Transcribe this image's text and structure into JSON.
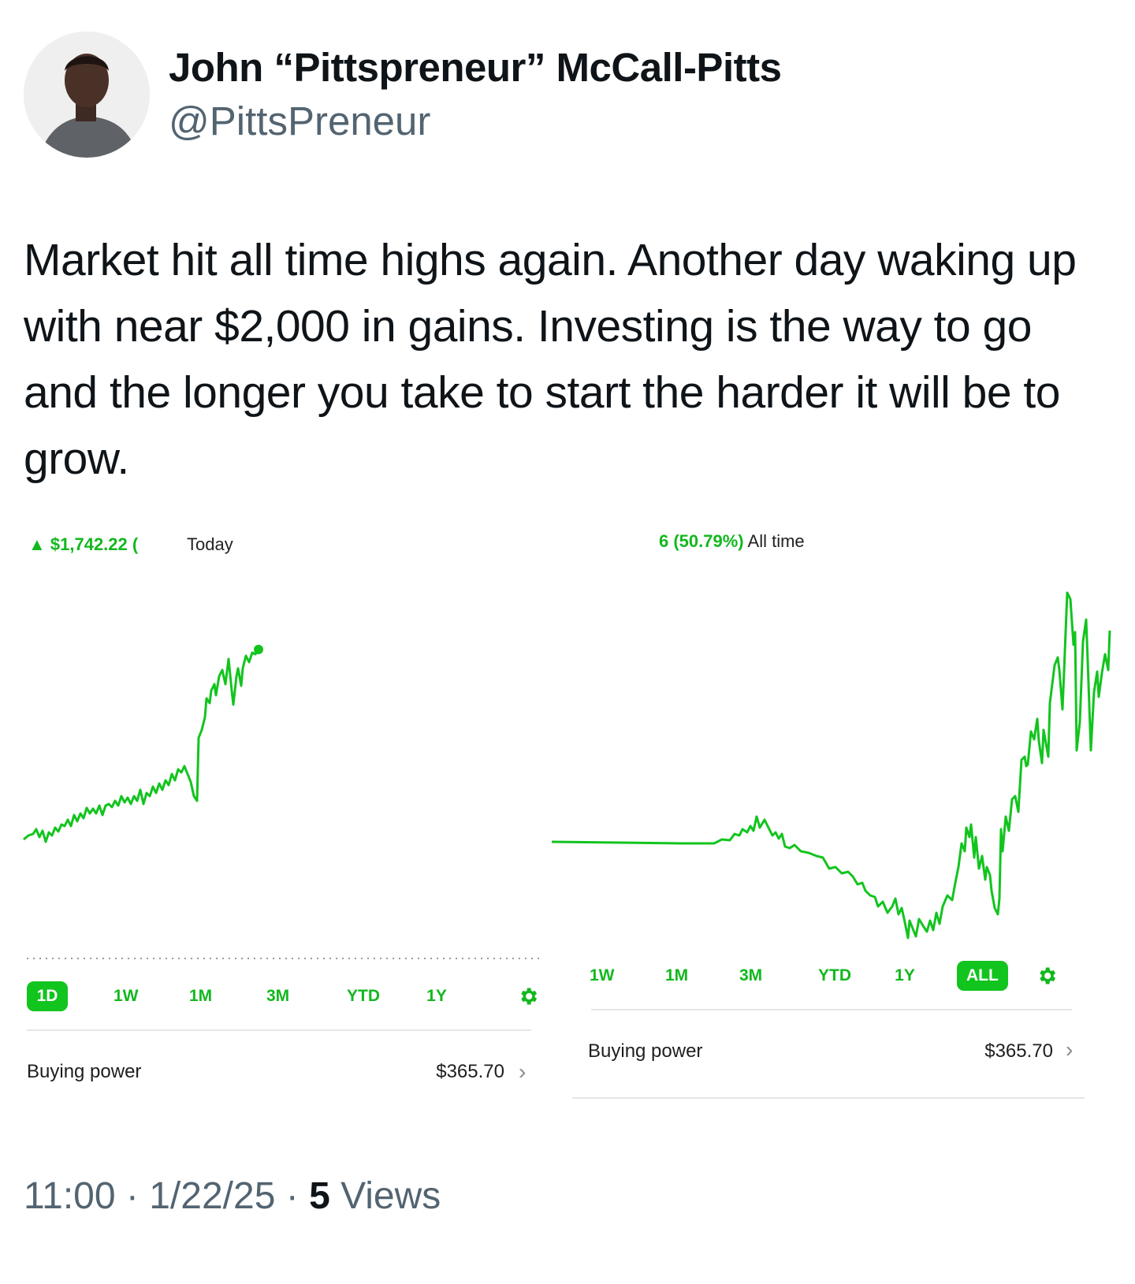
{
  "author": {
    "name": "John “Pittspreneur” McCall-Pitts",
    "handle": "@PittsPreneur"
  },
  "tweet": {
    "text": "Market hit all time highs again. Another day waking up with near $2,000 in gains. Investing is the way to go and the longer you take to start the harder it will be to grow."
  },
  "screenshot_left": {
    "gain_text": "▲ $1,742.22 (",
    "period": "Today",
    "ranges": [
      "1D",
      "1W",
      "1M",
      "3M",
      "YTD",
      "1Y"
    ],
    "active_range": "1D",
    "buying_power_label": "Buying power",
    "buying_power_value": "$365.70"
  },
  "screenshot_right": {
    "gain_text": "6 (50.79%)",
    "period": "All time",
    "ranges": [
      "1W",
      "1M",
      "3M",
      "YTD",
      "1Y",
      "ALL"
    ],
    "active_range": "ALL",
    "buying_power_label": "Buying power",
    "buying_power_value": "$365.70"
  },
  "footer": {
    "time": "11:00",
    "date": "1/22/25",
    "views_count": "5",
    "views_label": "Views"
  },
  "colors": {
    "accent": "#12b81e",
    "muted": "#536471",
    "text": "#0f1419"
  },
  "icons": [
    "gear-icon",
    "chevron-right-icon",
    "triangle-up-icon",
    "avatar"
  ]
}
